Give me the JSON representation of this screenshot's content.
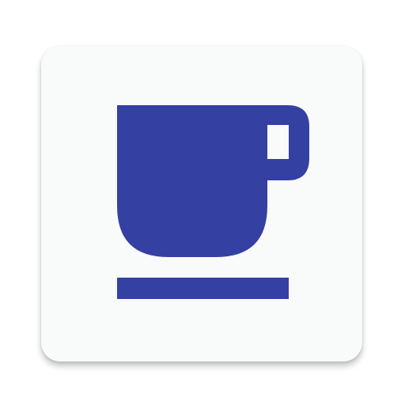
{
  "app_icon": {
    "icon": "coffee-cup-icon",
    "background_color": "#f9fafa",
    "glyph_color": "#3540a3"
  }
}
